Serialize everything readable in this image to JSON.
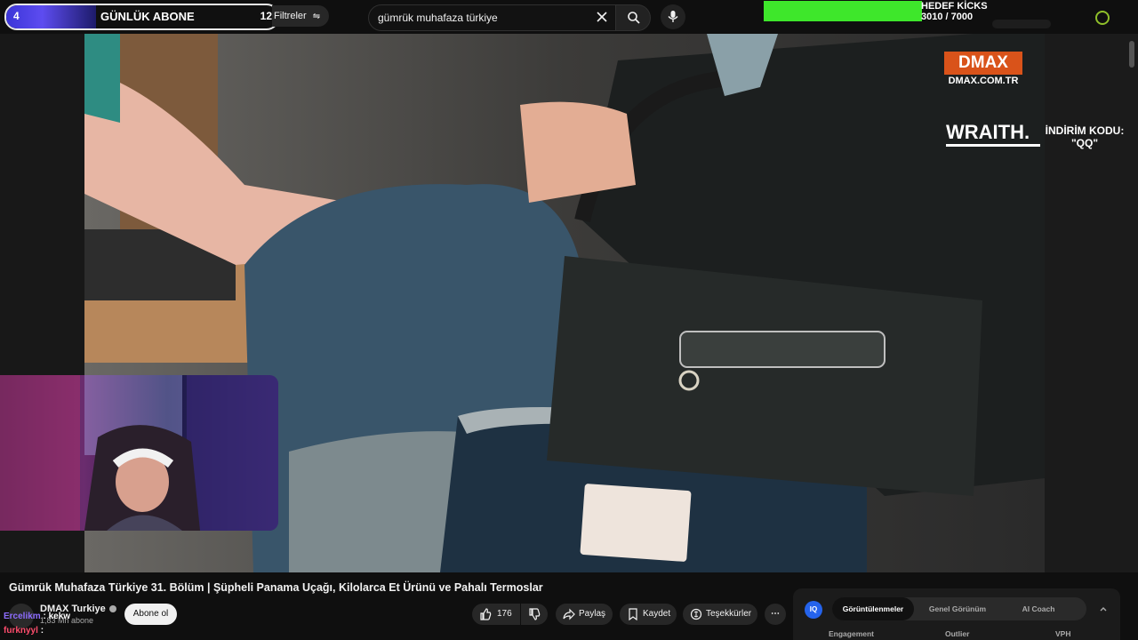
{
  "topbar": {
    "subscriber_goal": {
      "left_number": "4",
      "label": "GÜNLÜK ABONE",
      "right_number": "12",
      "progress": 0.33,
      "bar_color": "#4a40e6"
    },
    "filters_label": "Filtreler",
    "search": {
      "query": "gümrük muhafaza türkiye"
    },
    "icons": [
      "close-icon",
      "search-icon",
      "mic-icon"
    ],
    "kicks_goal": {
      "title": "HEDEF KİCKS",
      "progress_text": "3010 / 7000",
      "bar_color": "#3ee72b",
      "progress": 0.43
    }
  },
  "video": {
    "brand_logo_top": "DMAX",
    "brand_logo_site": "DMAX.COM.TR",
    "sponsor_name": "WRAITH.",
    "promo_text": "İNDİRİM KODU:",
    "promo_code": "\"QQ\""
  },
  "video_info": {
    "title": "Gümrük Muhafaza Türkiye 31. Bölüm | Şüpheli Panama Uçağı, Kilolarca Et Ürünü ve Pahalı Termoslar",
    "channel_name": "DMAX Turkiye",
    "subscribers": "1,83 Mn abone",
    "subscribe_label": "Abone ol",
    "like_count": "176",
    "share_label": "Paylaş",
    "save_label": "Kaydet",
    "thanks_label": "Teşekkürler"
  },
  "chat": [
    {
      "user": "Ercelikm",
      "message": ": kekw"
    },
    {
      "user": "furknyyl",
      "message": ":"
    }
  ],
  "extension_panel": {
    "badge": "IQ",
    "tabs": [
      "Görüntülenmeler",
      "Genel Görünüm",
      "AI Coach"
    ],
    "active_tab": 0,
    "metrics": [
      "Engagement",
      "Outlier",
      "VPH"
    ]
  }
}
